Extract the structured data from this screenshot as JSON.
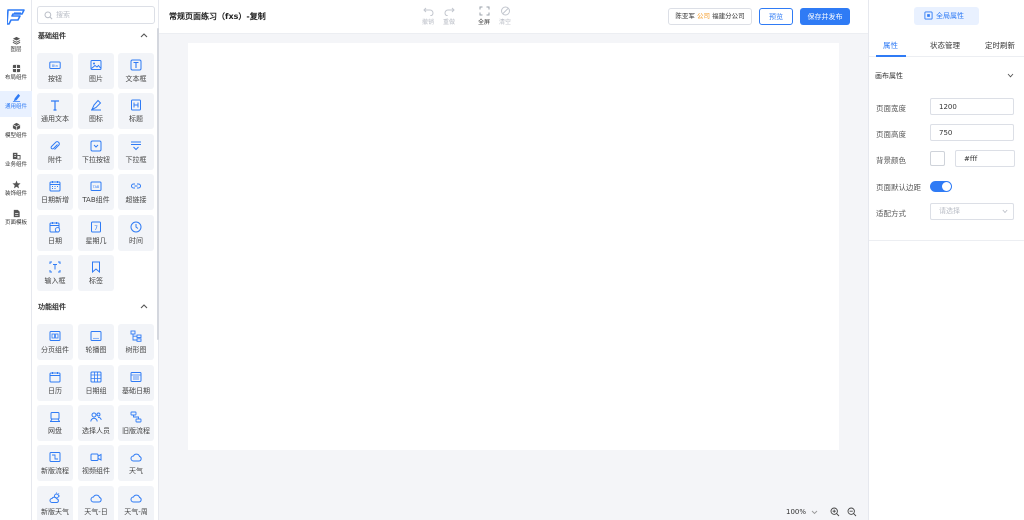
{
  "rail": {
    "items": [
      {
        "label": "图层",
        "icon": "layers-icon"
      },
      {
        "label": "布局组件",
        "icon": "layout-icon"
      },
      {
        "label": "通用组件",
        "icon": "pen-icon",
        "active": true
      },
      {
        "label": "模型组件",
        "icon": "cube-icon"
      },
      {
        "label": "业务组件",
        "icon": "business-icon"
      },
      {
        "label": "装饰组件",
        "icon": "decoration-icon"
      },
      {
        "label": "页面模板",
        "icon": "template-icon"
      }
    ]
  },
  "panel": {
    "search_placeholder": "搜索",
    "sections": [
      {
        "title": "基础组件"
      },
      {
        "title": "功能组件"
      }
    ],
    "basic": [
      "按钮",
      "图片",
      "文本框",
      "通用文本",
      "图标",
      "标题",
      "附件",
      "下拉按钮",
      "下拉框",
      "日期新增",
      "TAB组件",
      "超链接",
      "日期",
      "星期几",
      "时间",
      "输入框",
      "标签"
    ],
    "functional": [
      "分页组件",
      "轮播图",
      "树形图",
      "日历",
      "日期组",
      "基础日期",
      "网盘",
      "选择人员",
      "旧版流程",
      "新版流程",
      "视频组件",
      "天气",
      "新版天气",
      "天气-日",
      "天气-周"
    ]
  },
  "topbar": {
    "title": "常规页面练习（fxs）-复制",
    "undo": "撤销",
    "redo": "重做",
    "fullscreen": "全屏",
    "clear": "清空",
    "user_name": "陈亚军",
    "user_company": "公司",
    "user_org": "福建分公司",
    "preview": "预览",
    "save_publish": "保存并发布"
  },
  "zoom": {
    "value": "100%"
  },
  "right": {
    "global_props": "全局属性",
    "tabs": [
      "属性",
      "状态管理",
      "定时刷新"
    ],
    "canvas_props_title": "画布属性",
    "page_width_label": "页面宽度",
    "page_width": "1200",
    "page_height_label": "页面高度",
    "page_height": "750",
    "bg_color_label": "背景颜色",
    "bg_color": "#fff",
    "default_margin_label": "页面默认边距",
    "default_margin_on": true,
    "fit_mode_label": "适配方式",
    "fit_mode_placeholder": "请选择"
  },
  "colors": {
    "accent": "#2f7bf5",
    "accent_light": "#e9f1ff",
    "company": "#f59a23"
  }
}
